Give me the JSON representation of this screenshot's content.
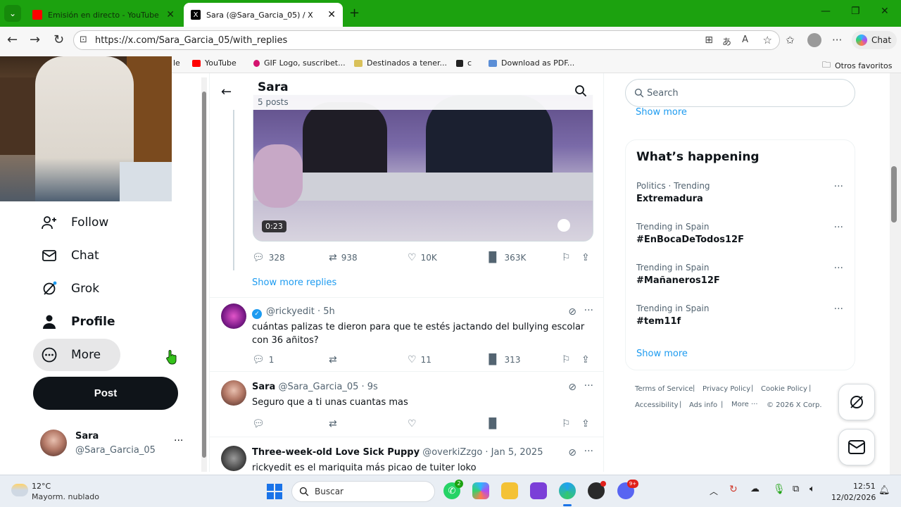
{
  "browser": {
    "tabs": [
      {
        "title": "Emisión en directo - YouTube Stud",
        "active": false
      },
      {
        "title": "Sara (@Sara_Garcia_05) / X",
        "active": true
      }
    ],
    "url": "https://x.com/Sara_Garcia_05/with_replies",
    "chat_label": "Chat",
    "bookmarks": [
      "le",
      "YouTube",
      "GIF Logo, suscribet...",
      "Destinados a tener...",
      "c",
      "Download as PDF..."
    ],
    "other_favorites": "Otros favoritos"
  },
  "nav": {
    "follow": "Follow",
    "chat": "Chat",
    "grok": "Grok",
    "profile": "Profile",
    "more": "More",
    "post": "Post",
    "account_name": "Sara",
    "account_handle": "@Sara_Garcia_05"
  },
  "header": {
    "name": "Sara",
    "posts": "5 posts"
  },
  "video": {
    "duration": "0:23",
    "replies": "328",
    "reposts": "938",
    "likes": "10K",
    "views": "363K"
  },
  "show_more_replies": "Show more replies",
  "replies": [
    {
      "name": "",
      "handle": "@rickyedit",
      "time": "· 5h",
      "text": "cuántas palizas te dieron para que te estés jactando del bullying escolar con 36 añitos?",
      "replies": "1",
      "reposts": "",
      "likes": "11",
      "views": "313"
    },
    {
      "name": "Sara",
      "handle": "@Sara_Garcia_05",
      "time": "· 9s",
      "text": "Seguro que a ti unas cuantas mas",
      "replies": "",
      "reposts": "",
      "likes": "",
      "views": ""
    },
    {
      "name": "Three-week-old Love Sick Puppy",
      "handle": "@overkiZzgo",
      "time": "· Jan 5, 2025",
      "text": "rickyedit es el mariquita más picao de tuiter loko",
      "replies": "",
      "reposts": "",
      "likes": "",
      "views": ""
    }
  ],
  "right": {
    "search_placeholder": "Search",
    "show_more_top": "Show more",
    "whats_happening": "What’s happening",
    "trends": [
      {
        "category": "Politics · Trending",
        "name": "Extremadura"
      },
      {
        "category": "Trending in Spain",
        "name": "#EnBocaDeTodos12F"
      },
      {
        "category": "Trending in Spain",
        "name": "#Mañaneros12F"
      },
      {
        "category": "Trending in Spain",
        "name": "#tem11f"
      }
    ],
    "show_more": "Show more",
    "footer": [
      "Terms of Service",
      "Privacy Policy",
      "Cookie Policy",
      "Accessibility",
      "Ads info",
      "More ···",
      "© 2026 X Corp."
    ]
  },
  "taskbar": {
    "temp": "12°C",
    "weather": "Mayorm. nublado",
    "search": "Buscar",
    "time": "12:51",
    "date": "12/02/2026",
    "whatsapp_badge": "2",
    "discord_badge": "9+"
  },
  "colors": {
    "titlebar": "#1ca20f",
    "x_blue": "#1d9bf0",
    "post_button": "#0f1419"
  }
}
